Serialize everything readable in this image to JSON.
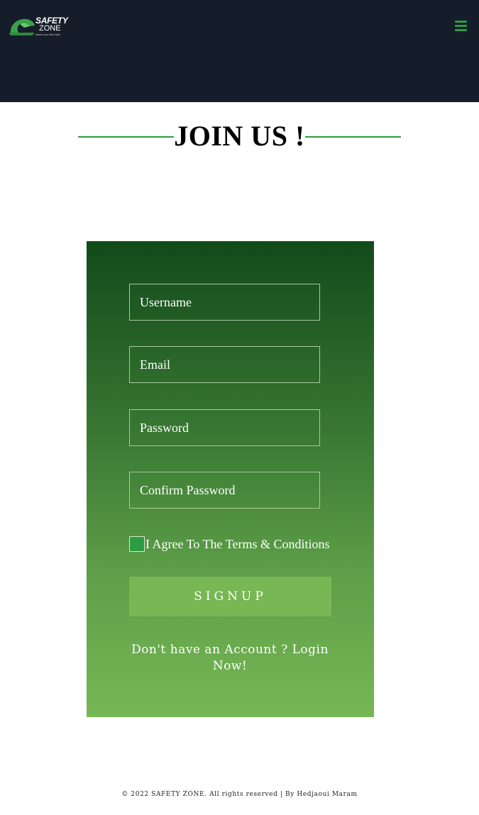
{
  "header": {
    "logo": {
      "line1": "SAFETY",
      "line2": "ZONE",
      "tagline": "where you feel safe"
    },
    "menu_icon": "hamburger-menu-icon",
    "background": "#161d2a"
  },
  "page": {
    "title": "JOIN US !"
  },
  "form": {
    "username_placeholder": "Username",
    "email_placeholder": "Email",
    "password_placeholder": "Password",
    "confirm_password_placeholder": "Confirm Password",
    "terms_label": "I Agree To The Terms & Conditions",
    "terms_checked": false,
    "signup_label": "SIGNUP",
    "login_prompt": "Don't have an Account ? Login Now!"
  },
  "footer": {
    "text": "© 2022 SAFETY ZONE. All rights reserved | By Hedjaoui Maram"
  },
  "colors": {
    "accent_green": "#2e9b45",
    "button_green": "#78b754",
    "card_top": "#124a1a",
    "card_bottom": "#76b754"
  }
}
